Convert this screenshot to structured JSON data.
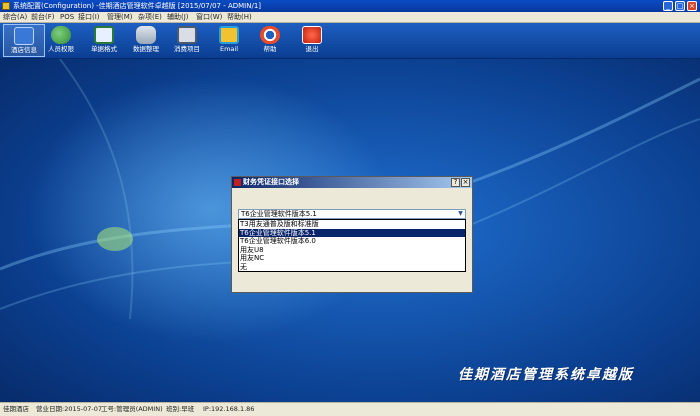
{
  "window": {
    "title": "系统配置(Configuration) -佳期酒店管理软件卓越版 [2015/07/07 - ADMIN/1]",
    "controls": [
      "_",
      "□",
      "×"
    ]
  },
  "menu": {
    "items": [
      "综合(A)",
      "前台(F)",
      "POS",
      "接口(I)",
      "管理(M)",
      "杂项(E)",
      "辅助(J)",
      "窗口(W)",
      "帮助(H)"
    ]
  },
  "toolbar": {
    "buttons": [
      {
        "label": "酒店信息",
        "icon": "hotel-info-icon"
      },
      {
        "label": "人员权限",
        "icon": "users-icon"
      },
      {
        "label": "单据格式",
        "icon": "form-format-icon"
      },
      {
        "label": "数据整理",
        "icon": "database-icon"
      },
      {
        "label": "消费项目",
        "icon": "items-icon"
      },
      {
        "label": "Email",
        "icon": "email-icon"
      },
      {
        "label": "帮助",
        "icon": "lifebuoy-icon"
      },
      {
        "label": "退出",
        "icon": "power-icon"
      }
    ]
  },
  "desktop": {
    "brand": "佳期酒店管理系统卓越版"
  },
  "dialog": {
    "title": "财务凭证接口选择",
    "help_button": "?",
    "close_button": "×",
    "selected_value": "T6企业管理软件版本5.1",
    "options": [
      "T3用友通普及版和标准版",
      "T6企业管理软件版本5.1",
      "T6企业管理软件版本6.0",
      "用友U8",
      "用友NC",
      "无"
    ],
    "highlighted_index": 1
  },
  "status": {
    "hotel": "佳期酒店",
    "business_date": "营业日期:2015-07-07",
    "operator": "工号:管理员(ADMIN)",
    "shift": "班别:早班",
    "ip": "IP:192.168.1.86"
  },
  "colors": {
    "titlebar": "#0a4cc5",
    "toolbar": "#1d5fc0",
    "desktop": "#0b3f8f",
    "highlight": "#0a246a"
  }
}
